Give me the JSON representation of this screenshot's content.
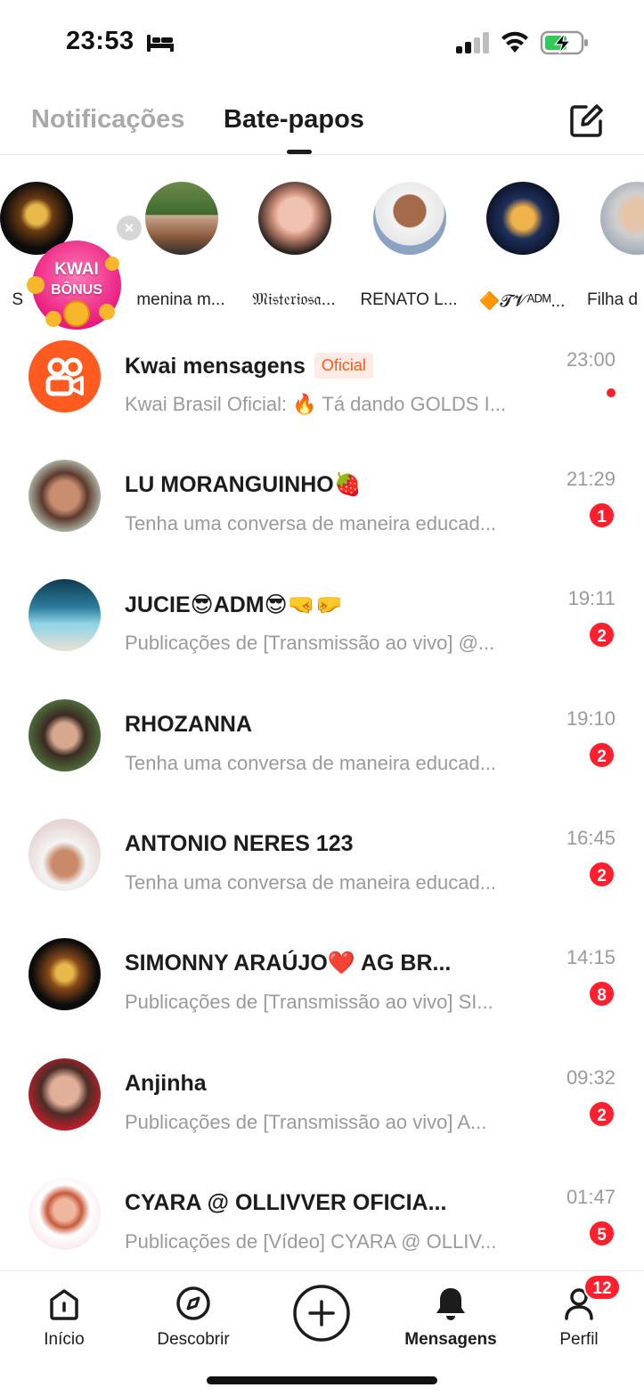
{
  "status_bar": {
    "time": "23:53",
    "icons": [
      "bed-icon",
      "signal-icon",
      "wifi-icon",
      "battery-charging-icon"
    ]
  },
  "header": {
    "tabs": [
      {
        "label": "Notificações",
        "active": false
      },
      {
        "label": "Bate-papos",
        "active": true
      }
    ],
    "compose_icon": "compose-icon"
  },
  "stories": [
    {
      "name": "S"
    },
    {
      "name": "menina m..."
    },
    {
      "name": "𝔐𝔦𝔰𝔱𝔢𝔯𝔦𝔬𝔰𝔞..."
    },
    {
      "name": "RENATO L..."
    },
    {
      "name": "🔶𝓣𝓥ᴬᴰᴹ..."
    },
    {
      "name": "Filha d"
    }
  ],
  "bonus": {
    "line1": "KWAI",
    "line2": "BÔNUS",
    "close": "×"
  },
  "chats": [
    {
      "name": "Kwai mensagens",
      "tag": "Oficial",
      "preview": "Kwai Brasil Oficial: 🔥 Tá dando GOLDS I...",
      "time": "23:00",
      "unread": ""
    },
    {
      "name": "LU MORANGUINHO🍓",
      "preview": "Tenha uma conversa de maneira educad...",
      "time": "21:29",
      "unread": "1"
    },
    {
      "name": "JUCIE😎ADM😎🤜🤛",
      "preview": "Publicações de [Transmissão ao vivo] @...",
      "time": "19:11",
      "unread": "2"
    },
    {
      "name": "RHOZANNA",
      "preview": "Tenha uma conversa de maneira educad...",
      "time": "19:10",
      "unread": "2"
    },
    {
      "name": "ANTONIO NERES 123",
      "preview": "Tenha uma conversa de maneira educad...",
      "time": "16:45",
      "unread": "2"
    },
    {
      "name": "SIMONNY ARAÚJO❤️ AG BR...",
      "preview": "Publicações de [Transmissão ao vivo] SI...",
      "time": "14:15",
      "unread": "8"
    },
    {
      "name": "Anjinha",
      "preview": "Publicações de [Transmissão ao vivo] A...",
      "time": "09:32",
      "unread": "2"
    },
    {
      "name": "CYARA @ OLLIVVER  OFICIA...",
      "preview": "Publicações de [Vídeo] CYARA @ OLLIV...",
      "time": "01:47",
      "unread": "5"
    }
  ],
  "bottom_nav": {
    "items": [
      {
        "label": "Início",
        "icon": "home-icon",
        "active": false
      },
      {
        "label": "Descobrir",
        "icon": "compass-icon",
        "active": false
      },
      {
        "label": "",
        "icon": "plus-circle-icon",
        "active": false
      },
      {
        "label": "Mensagens",
        "icon": "bell-icon",
        "active": true
      },
      {
        "label": "Perfil",
        "icon": "person-icon",
        "active": false
      }
    ],
    "profile_badge": "12"
  },
  "colors": {
    "accent_red": "#ff1f2d",
    "kwai_orange": "#ff5a1f",
    "text_primary": "#1c1c1c",
    "text_secondary": "#9a9a9a"
  }
}
